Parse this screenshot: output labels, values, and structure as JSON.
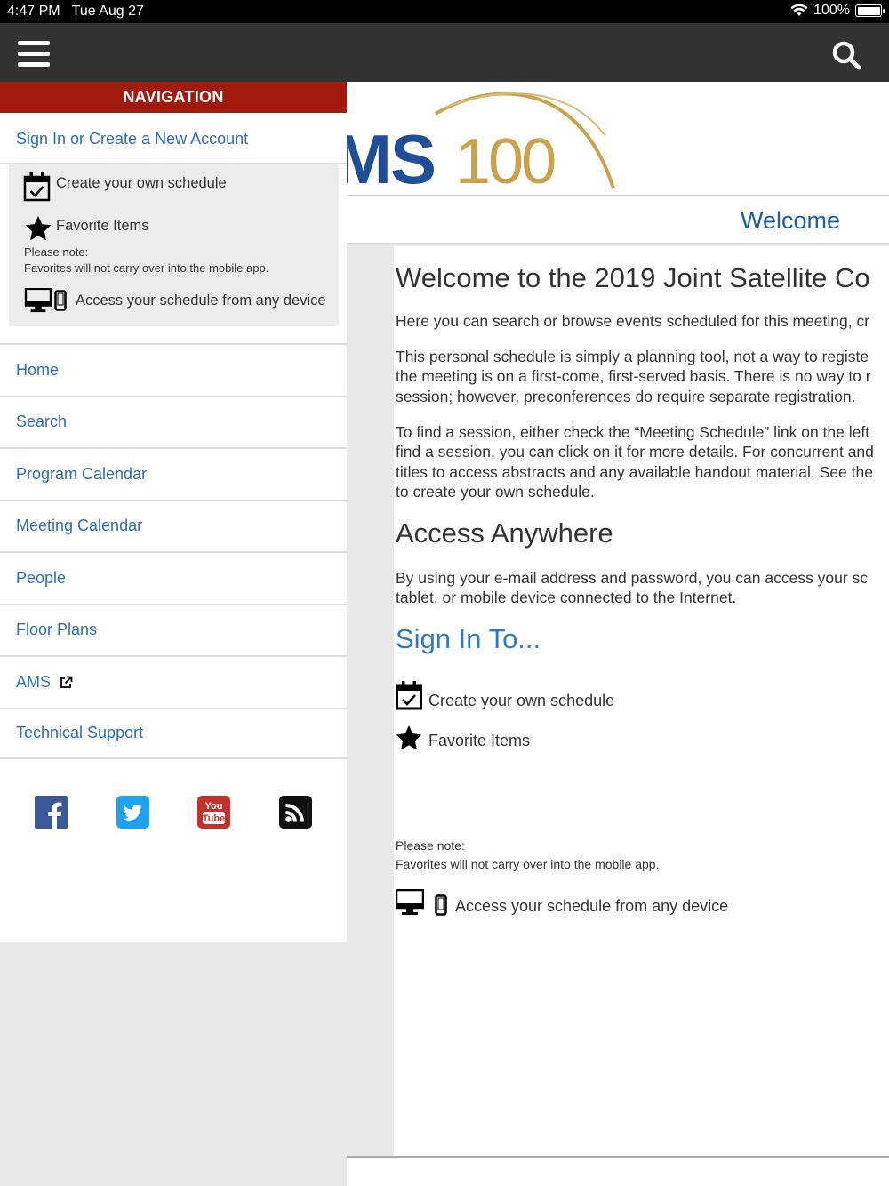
{
  "status": {
    "time": "4:47 PM",
    "date": "Tue Aug 27",
    "battery": "100%"
  },
  "topbar": {
    "menu_icon": "hamburger-menu-icon",
    "search_icon": "search-icon"
  },
  "drawer": {
    "header": "NAVIGATION",
    "sign_in": "Sign In or Create a New Account",
    "features": {
      "schedule": "Create your own schedule",
      "favorites": "Favorite Items",
      "note_label": "Please note:",
      "note_text": "Favorites will not carry over into the mobile app.",
      "access": "Access your schedule from any device"
    },
    "nav_items": [
      "Home",
      "Search",
      "Program Calendar",
      "Meeting Calendar",
      "People",
      "Floor Plans",
      "AMS",
      "Technical Support"
    ],
    "social": [
      "facebook-icon",
      "twitter-icon",
      "youtube-icon",
      "rss-icon"
    ]
  },
  "main": {
    "logo_text": "MS100",
    "tab_label": "Welcome",
    "title": "Welcome to the 2019 Joint Satellite Co",
    "para1": "Here you can search or browse events scheduled for this meeting, cr",
    "para2": "This personal schedule is simply a planning tool, not a way to registe\nthe meeting is on a first-come, first-served basis. There is no way to r\nsession; however, preconferences do require separate registration.",
    "para3": "To find a session, either check the “Meeting Schedule” link on the left\nfind a session, you can click on it for more details. For concurrent and\ntitles to access abstracts and any available handout material. See the\nto create your own schedule.",
    "access_heading": "Access Anywhere",
    "para4": "By using your e-mail address and password, you can access your sc\ntablet, or mobile device connected to the Internet.",
    "signin_heading": "Sign In To...",
    "feature_schedule": "Create your own schedule",
    "feature_favorites": "Favorite Items",
    "note_label": "Please note:",
    "note_text": "Favorites will not carry over into the mobile app.",
    "feature_access": "Access your schedule from any device"
  },
  "colors": {
    "nav_header": "#a11a0c",
    "link": "#2c6db5",
    "topbar": "#323232",
    "logo_blue": "#1f4f96",
    "logo_gold": "#c9a24a"
  }
}
